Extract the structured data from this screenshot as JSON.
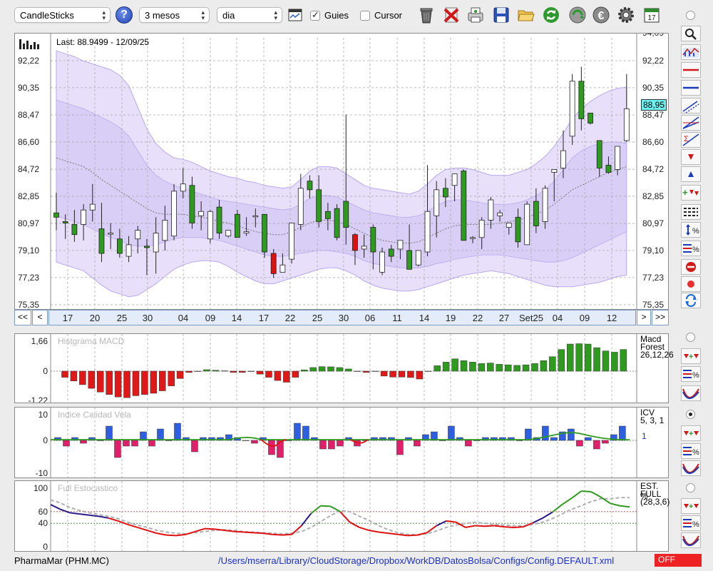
{
  "toolbar": {
    "chart_type": "CandleSticks",
    "period": "3 mesos",
    "interval": "dia",
    "guides_label": "Guies",
    "guides_checked": true,
    "cursor_label": "Cursor",
    "cursor_checked": false,
    "help_label": "?",
    "calendar_day": "17"
  },
  "price_panel": {
    "last_label": "Last: 88.9499 - 12/09/25",
    "current_price": "88,95",
    "y_ticks": [
      "92,22",
      "90,35",
      "88,47",
      "86,60",
      "84,72",
      "82,85",
      "80,97",
      "79,10",
      "77,23",
      "75,35"
    ],
    "y_top_partial": "94,09",
    "nav_prev_far": "<<",
    "nav_prev": "<",
    "nav_next": ">",
    "nav_next_far": ">>",
    "x_labels": [
      "17",
      "20",
      "25",
      "30",
      "04",
      "09",
      "14",
      "17",
      "22",
      "25",
      "30",
      "06",
      "11",
      "14",
      "19",
      "22",
      "27",
      "Set25",
      "04",
      "09",
      "12"
    ]
  },
  "macd_panel": {
    "title": "Histgrama MACD",
    "y_ticks": [
      "1,66",
      "0",
      "-1,22"
    ],
    "side_label_1": "Macd",
    "side_label_2": "Forest",
    "side_label_3": "26,12,26"
  },
  "icv_panel": {
    "title": "Indice Calidad Vela",
    "y_ticks": [
      "10",
      "0",
      "-10"
    ],
    "side_label_1": "ICV",
    "side_label_2": "5, 3, 1",
    "side_value": "1"
  },
  "stoch_panel": {
    "title": "Full Estocastico",
    "y_ticks": [
      "100",
      "60",
      "40",
      "0"
    ],
    "side_label_1": "EST. %",
    "side_label_2": "FULL",
    "side_label_3": "(28,3,6)"
  },
  "status": {
    "instrument": "PharmaMar (PHM.MC)",
    "config_path": "/Users/mserra/Library/CloudStorage/Dropbox/WorkDB/DatosBolsa/Configs/Config.DEFAULT.xml",
    "off_label": "OFF"
  },
  "colors": {
    "up": "#2e9a1e",
    "down": "#e01010",
    "band": "#e8e0fa",
    "band_inner": "#d9cef6",
    "macd_neg": "#e01818",
    "macd_pos": "#2e9a1e",
    "icv_pos": "#2e5fe0",
    "icv_neg": "#e0206a",
    "k_line": "#e01010",
    "d_line": "#b0b0b0",
    "overbought_line": "#2e9a1e",
    "oversold_line": "#2a1a8a"
  },
  "chart_data": [
    {
      "type": "candlestick",
      "title": "Last: 88.9499 - 12/09/25",
      "ylim": [
        75.35,
        94.09
      ],
      "y_ticks": [
        92.22,
        90.35,
        88.47,
        86.6,
        84.72,
        82.85,
        80.97,
        79.1,
        77.23,
        75.35
      ],
      "x_labels": [
        "17",
        "20",
        "25",
        "30",
        "04",
        "09",
        "14",
        "17",
        "22",
        "25",
        "30",
        "06",
        "11",
        "14",
        "19",
        "22",
        "27",
        "Set25",
        "04",
        "09",
        "12"
      ],
      "last_value": 88.95,
      "candles": [
        [
          81.7,
          83.1,
          80.5,
          81.4
        ],
        [
          81.1,
          81.6,
          79.9,
          81.0
        ],
        [
          80.9,
          81.9,
          79.7,
          80.2
        ],
        [
          80.9,
          82.3,
          79.8,
          81.9
        ],
        [
          81.9,
          83.7,
          81.1,
          82.3
        ],
        [
          80.6,
          82.4,
          78.3,
          78.9
        ],
        [
          80.3,
          81.0,
          79.2,
          80.3
        ],
        [
          79.9,
          80.6,
          78.6,
          78.9
        ],
        [
          78.7,
          80.1,
          78.3,
          79.5
        ],
        [
          79.9,
          80.8,
          78.9,
          80.5
        ],
        [
          79.4,
          79.9,
          77.4,
          79.3
        ],
        [
          79.0,
          81.4,
          77.5,
          80.3
        ],
        [
          79.8,
          82.2,
          79.1,
          81.2
        ],
        [
          80.1,
          83.7,
          79.8,
          83.2
        ],
        [
          83.2,
          84.8,
          82.7,
          83.7
        ],
        [
          83.6,
          84.2,
          80.6,
          81.0
        ],
        [
          81.5,
          82.5,
          80.5,
          81.8
        ],
        [
          79.9,
          81.9,
          79.6,
          81.8
        ],
        [
          82.1,
          82.6,
          79.9,
          80.3
        ],
        [
          80.1,
          80.4,
          80.0,
          80.5
        ],
        [
          81.6,
          81.9,
          80.0,
          80.0
        ],
        [
          80.3,
          81.4,
          80.1,
          80.4
        ],
        [
          81.5,
          82.0,
          80.7,
          81.5
        ],
        [
          81.6,
          81.6,
          78.6,
          79.0
        ],
        [
          78.9,
          79.2,
          77.2,
          77.5
        ],
        [
          77.6,
          78.9,
          77.6,
          78.1
        ],
        [
          78.5,
          81.0,
          78.2,
          81.0
        ],
        [
          80.9,
          84.4,
          80.5,
          83.4
        ],
        [
          83.9,
          84.3,
          82.7,
          83.3
        ],
        [
          83.3,
          84.3,
          80.7,
          81.1
        ],
        [
          81.8,
          82.4,
          80.5,
          81.3
        ],
        [
          82.0,
          82.3,
          79.8,
          80.0
        ],
        [
          82.5,
          88.5,
          79.5,
          80.7
        ],
        [
          80.2,
          80.3,
          78.1,
          79.1
        ],
        [
          79.2,
          80.2,
          78.6,
          79.4
        ],
        [
          80.7,
          80.9,
          77.8,
          79.0
        ],
        [
          77.6,
          79.3,
          77.4,
          79.0
        ],
        [
          79.2,
          79.5,
          78.3,
          78.7
        ],
        [
          79.2,
          79.8,
          78.5,
          79.8
        ],
        [
          79.1,
          80.9,
          78.0,
          77.8
        ],
        [
          78.1,
          79.0,
          78.0,
          79.1
        ],
        [
          79.0,
          85.0,
          78.7,
          81.8
        ],
        [
          81.5,
          83.9,
          80.0,
          83.3
        ],
        [
          83.4,
          84.1,
          82.1,
          82.8
        ],
        [
          83.6,
          84.4,
          82.5,
          84.4
        ],
        [
          84.6,
          84.7,
          80.2,
          79.8
        ],
        [
          80.0,
          80.1,
          79.6,
          80.0
        ],
        [
          80.0,
          81.4,
          79.2,
          81.2
        ],
        [
          81.2,
          82.8,
          80.6,
          82.6
        ],
        [
          81.5,
          81.9,
          81.1,
          81.7
        ],
        [
          80.7,
          81.0,
          80.2,
          81.0
        ],
        [
          81.4,
          82.0,
          79.3,
          79.7
        ],
        [
          79.5,
          82.5,
          80.0,
          82.3
        ],
        [
          82.5,
          83.4,
          80.3,
          80.8
        ],
        [
          81.1,
          83.6,
          80.6,
          83.4
        ],
        [
          84.5,
          84.7,
          82.5,
          84.7
        ],
        [
          84.8,
          87.4,
          84.1,
          86.0
        ],
        [
          87.0,
          91.3,
          86.4,
          90.8
        ],
        [
          90.8,
          91.8,
          87.4,
          88.2
        ],
        [
          88.6,
          88.6,
          87.8,
          87.9
        ],
        [
          86.7,
          86.7,
          84.2,
          84.8
        ],
        [
          85.0,
          85.6,
          84.4,
          84.5
        ],
        [
          84.7,
          86.2,
          84.3,
          86.3
        ],
        [
          86.7,
          91.3,
          86.6,
          88.9
        ]
      ],
      "bollinger_upper": [
        92.9,
        92.7,
        92.5,
        92.2,
        92.0,
        91.8,
        91.6,
        91.2,
        90.5,
        89.0,
        87.5,
        86.5,
        85.9,
        85.5,
        85.4,
        85.2,
        84.9,
        84.6,
        84.4,
        84.2,
        84.1,
        83.9,
        83.8,
        83.6,
        83.5,
        83.4,
        83.5,
        84.0,
        84.6,
        84.9,
        84.9,
        84.8,
        84.4,
        84.0,
        83.6,
        83.4,
        83.3,
        83.2,
        83.1,
        83.0,
        83.2,
        83.7,
        84.3,
        84.7,
        84.8,
        84.8,
        84.7,
        84.5,
        84.3,
        84.3,
        84.3,
        84.5,
        84.7,
        85.1,
        85.6,
        86.3,
        87.2,
        88.2,
        88.9,
        89.4,
        89.8,
        90.1,
        90.3,
        90.4
      ],
      "bollinger_lower": [
        78.3,
        78.1,
        77.9,
        77.7,
        77.2,
        76.7,
        76.3,
        76.1,
        75.9,
        76.0,
        76.4,
        76.8,
        77.3,
        77.8,
        78.1,
        78.3,
        78.4,
        78.4,
        78.3,
        78.0,
        77.6,
        77.3,
        77.0,
        76.8,
        76.8,
        77.0,
        77.2,
        77.4,
        77.6,
        77.8,
        77.9,
        77.9,
        77.7,
        77.4,
        77.0,
        76.7,
        76.5,
        76.4,
        76.3,
        76.3,
        76.4,
        76.6,
        76.8,
        77.0,
        77.2,
        77.4,
        77.5,
        77.6,
        77.7,
        77.6,
        77.5,
        77.3,
        77.1,
        76.9,
        76.7,
        76.6,
        76.6,
        76.6,
        76.7,
        76.8,
        76.9,
        77.1,
        77.3,
        77.4
      ],
      "bollinger_inner_upper": [
        89.5,
        89.3,
        89.1,
        88.9,
        88.6,
        88.3,
        88.0,
        87.6,
        87.0,
        86.0,
        85.0,
        84.3,
        83.9,
        83.6,
        83.4,
        83.2,
        83.0,
        82.8,
        82.6,
        82.5,
        82.4,
        82.3,
        82.2,
        82.1,
        82.0,
        81.9,
        82.0,
        82.3,
        82.7,
        82.9,
        82.9,
        82.8,
        82.5,
        82.2,
        81.9,
        81.7,
        81.6,
        81.5,
        81.4,
        81.4,
        81.5,
        81.8,
        82.2,
        82.5,
        82.6,
        82.6,
        82.5,
        82.4,
        82.3,
        82.3,
        82.3,
        82.4,
        82.6,
        82.9,
        83.3,
        83.9,
        84.7,
        85.5,
        86.0,
        86.3,
        86.5,
        86.6,
        86.6,
        86.5
      ],
      "bollinger_inner_lower": [
        81.5,
        81.3,
        81.1,
        80.9,
        80.6,
        80.3,
        80.0,
        79.8,
        79.5,
        79.4,
        79.4,
        79.5,
        79.7,
        79.9,
        80.0,
        80.0,
        80.0,
        79.9,
        79.8,
        79.6,
        79.4,
        79.2,
        79.0,
        78.8,
        78.7,
        78.7,
        78.8,
        78.9,
        79.0,
        79.1,
        79.1,
        79.0,
        78.9,
        78.7,
        78.4,
        78.2,
        78.1,
        78.0,
        77.9,
        77.9,
        77.9,
        78.0,
        78.2,
        78.3,
        78.5,
        78.6,
        78.7,
        78.8,
        78.8,
        78.8,
        78.7,
        78.6,
        78.5,
        78.4,
        78.3,
        78.3,
        78.4,
        78.6,
        78.9,
        79.2,
        79.5,
        79.8,
        80.1,
        80.4
      ],
      "moving_average": [
        85.5,
        85.3,
        85.1,
        84.9,
        84.5,
        84.0,
        83.6,
        83.2,
        82.8,
        82.4,
        82.0,
        81.7,
        81.6,
        81.6,
        81.6,
        81.5,
        81.4,
        81.3,
        81.1,
        81.0,
        80.8,
        80.6,
        80.4,
        80.3,
        80.2,
        80.2,
        80.4,
        80.7,
        81.0,
        81.2,
        81.2,
        81.1,
        80.9,
        80.6,
        80.3,
        80.0,
        79.8,
        79.7,
        79.6,
        79.6,
        79.7,
        80.0,
        80.3,
        80.6,
        80.8,
        80.9,
        80.9,
        80.9,
        80.9,
        81.0,
        81.1,
        81.2,
        81.4,
        81.6,
        81.9,
        82.3,
        82.8,
        83.3,
        83.6,
        83.9,
        84.2,
        84.5,
        84.7,
        84.9
      ]
    },
    {
      "type": "bar",
      "title": "Histgrama MACD",
      "ylim": [
        -1.22,
        1.66
      ],
      "values": [
        -0.25,
        -0.4,
        -0.55,
        -0.7,
        -0.85,
        -0.95,
        -1.05,
        -1.08,
        -1.0,
        -0.95,
        -0.9,
        -0.8,
        -0.6,
        -0.3,
        -0.05,
        0,
        0.08,
        0.05,
        0.02,
        -0.05,
        -0.05,
        0,
        -0.12,
        -0.25,
        -0.38,
        -0.45,
        -0.25,
        0.07,
        0.2,
        0.25,
        0.24,
        0.2,
        0.12,
        0,
        -0.05,
        0,
        -0.2,
        -0.24,
        -0.24,
        -0.26,
        -0.32,
        0,
        0.3,
        0.5,
        0.68,
        0.58,
        0.5,
        0.42,
        0.45,
        0.38,
        0.35,
        0.32,
        0.35,
        0.42,
        0.58,
        0.8,
        1.2,
        1.5,
        1.52,
        1.5,
        1.3,
        1.12,
        1.05,
        1.2
      ]
    },
    {
      "type": "bar",
      "title": "Indice Calidad Vela",
      "ylim": [
        -10,
        10
      ],
      "values": [
        1,
        -2,
        1,
        -1,
        1,
        0,
        5,
        -6,
        -2,
        -2,
        3,
        -2,
        4,
        0,
        6,
        1,
        -4,
        1,
        1,
        1,
        2,
        1,
        0,
        -1,
        1,
        -5,
        -6,
        0,
        6,
        5,
        1,
        -3,
        -3,
        -2,
        1,
        -2,
        0,
        1,
        1,
        1,
        -5,
        1,
        -2,
        2,
        3,
        0,
        5,
        1,
        -2,
        0,
        1,
        1,
        1,
        1,
        0,
        4,
        1,
        5,
        1,
        3,
        4,
        -2,
        1,
        -3,
        -1,
        2,
        5
      ]
    },
    {
      "type": "line",
      "title": "Full Estocastico",
      "ylim": [
        0,
        100
      ],
      "reference_lines": [
        60,
        40
      ],
      "series": [
        {
          "values": [
            72,
            64,
            58,
            56,
            54,
            52,
            49,
            44,
            38,
            33,
            28,
            23,
            20,
            19,
            21,
            26,
            31,
            30,
            28,
            26,
            25,
            24,
            23,
            21,
            20,
            21,
            36,
            57,
            70,
            69,
            60,
            42,
            33,
            28,
            25,
            23,
            21,
            19,
            20,
            24,
            36,
            44,
            42,
            33,
            36,
            35,
            36,
            34,
            33,
            34,
            41,
            49,
            59,
            72,
            83,
            95,
            94,
            85,
            74,
            70,
            68
          ]
        },
        {
          "values": [
            80,
            75,
            67,
            62,
            58,
            55,
            52,
            48,
            42,
            37,
            33,
            28,
            25,
            23,
            22,
            24,
            26,
            28,
            29,
            28,
            26,
            25,
            24,
            23,
            22,
            23,
            26,
            33,
            43,
            53,
            62,
            60,
            52,
            45,
            36,
            29,
            24,
            21,
            20,
            22,
            27,
            33,
            37,
            40,
            42,
            40,
            38,
            37,
            36,
            36,
            38,
            42,
            48,
            56,
            64,
            70,
            77,
            82,
            82,
            84,
            84
          ]
        }
      ]
    }
  ]
}
